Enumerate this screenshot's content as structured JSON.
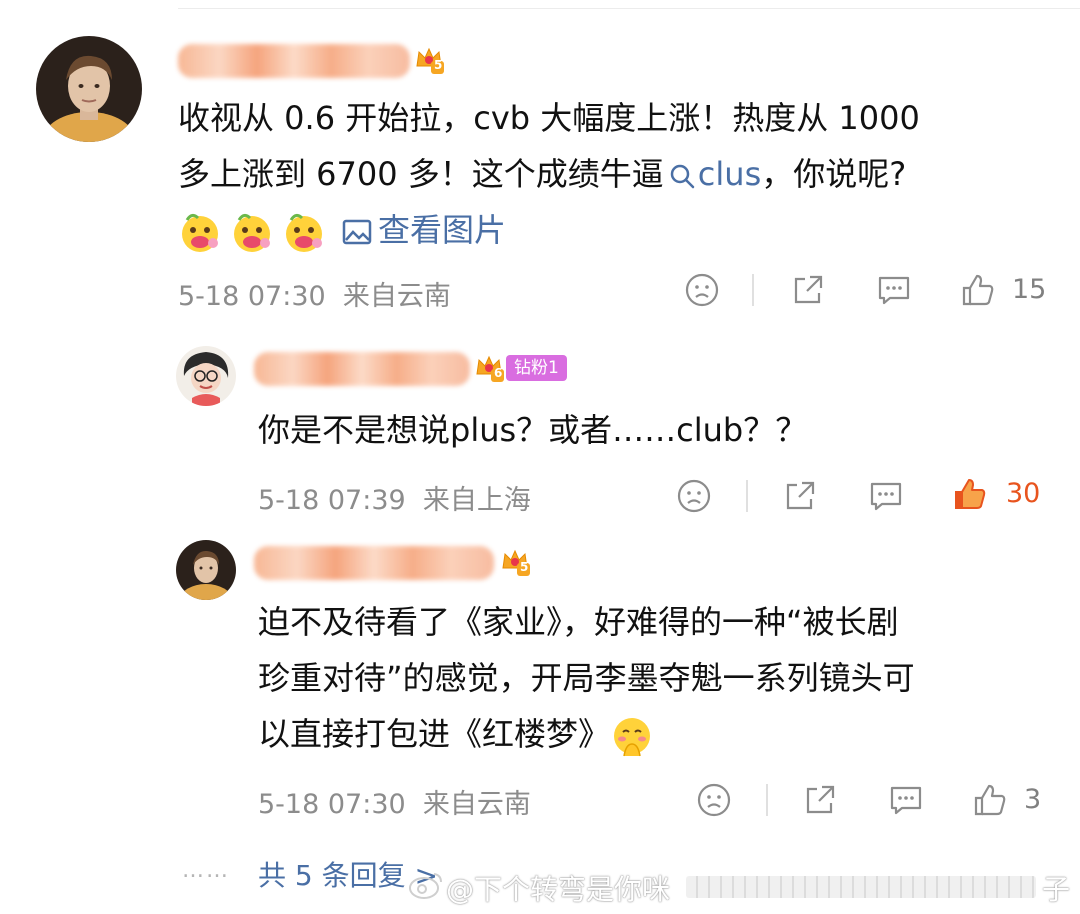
{
  "comment": {
    "line1": "收视从 0.6 开始拉，cvb 大幅度上涨！热度从 1000",
    "line2_before": "多上涨到 6700 多！这个成绩牛逼",
    "search_link": "clus",
    "line2_after": "，你说呢?",
    "view_image": "查看图片",
    "level_badge": "5",
    "time": "5-18 07:30",
    "location": "来自云南",
    "like_count": "15"
  },
  "reply1": {
    "level_badge": "6",
    "fan_badge": "钻粉1",
    "text": "你是不是想说plus？或者……club？？",
    "time": "5-18 07:39",
    "location": "来自上海",
    "like_count": "30"
  },
  "reply2": {
    "level_badge": "5",
    "line1": "迫不及待看了《家业》，好难得的一种“被长剧",
    "line2": "珍重对待”的感觉，开局李墨夺魁一系列镜头可",
    "line3": "以直接打包进《红楼梦》",
    "time": "5-18 07:30",
    "location": "来自云南",
    "like_count": "3"
  },
  "footer": {
    "dots": "……",
    "more_replies": "共 5 条回复 >",
    "watermark": "@下个转弯是你咪",
    "watermark_tail": "子"
  },
  "colors": {
    "link": "#4a6fa5",
    "like_active": "#e8541e",
    "meta_gray": "#8c8c8c"
  },
  "icons": [
    "search-icon",
    "image-icon",
    "sad-face-icon",
    "share-icon",
    "comment-icon",
    "like-icon",
    "crown-badge-icon",
    "emoji-flower-face",
    "emoji-shy-face"
  ]
}
